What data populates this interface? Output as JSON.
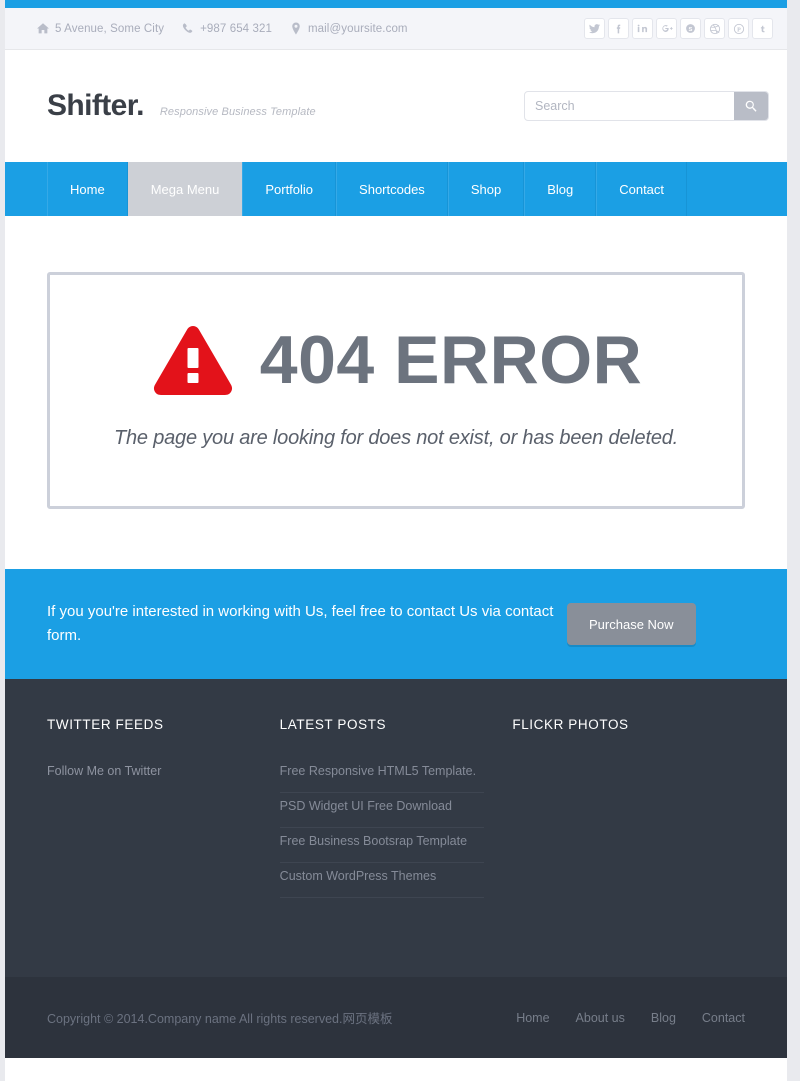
{
  "topbar": {
    "contacts": [
      {
        "icon": "home-icon",
        "text": "5 Avenue, Some City"
      },
      {
        "icon": "phone-icon",
        "text": "+987 654 321"
      },
      {
        "icon": "map-pin-icon",
        "text": "mail@yoursite.com"
      }
    ],
    "social": [
      {
        "name": "twitter-icon",
        "glyph": "t"
      },
      {
        "name": "facebook-icon",
        "glyph": "f"
      },
      {
        "name": "linkedin-icon",
        "glyph": "in"
      },
      {
        "name": "google-plus-icon",
        "glyph": "g+"
      },
      {
        "name": "skype-icon",
        "glyph": "s"
      },
      {
        "name": "dribbble-icon",
        "glyph": "d"
      },
      {
        "name": "pinterest-icon",
        "glyph": "p"
      },
      {
        "name": "tumblr-icon",
        "glyph": "t"
      }
    ]
  },
  "header": {
    "brand": "Shifter.",
    "tagline": "Responsive Business Template",
    "search_placeholder": "Search",
    "search_value": ""
  },
  "nav": {
    "items": [
      {
        "label": "Home",
        "active": false
      },
      {
        "label": "Mega Menu",
        "active": true
      },
      {
        "label": "Portfolio",
        "active": false
      },
      {
        "label": "Shortcodes",
        "active": false
      },
      {
        "label": "Shop",
        "active": false
      },
      {
        "label": "Blog",
        "active": false
      },
      {
        "label": "Contact",
        "active": false
      }
    ]
  },
  "error": {
    "icon": "warning-triangle-icon",
    "title": "404 ERROR",
    "subtitle": "The page you are looking for does not exist, or has been deleted."
  },
  "cta": {
    "text": "If you you're interested in working with Us, feel free to contact Us via contact form.",
    "button_label": "Purchase Now"
  },
  "footer": {
    "twitter": {
      "title": "TWITTER FEEDS",
      "follow_text": "Follow Me on Twitter"
    },
    "posts": {
      "title": "LATEST POSTS",
      "items": [
        "Free Responsive HTML5 Template.",
        "PSD Widget UI Free Download",
        "Free Business Bootsrap Template",
        "Custom WordPress Themes"
      ]
    },
    "flickr": {
      "title": "FLICKR PHOTOS",
      "photos": []
    }
  },
  "bottombar": {
    "copyright": "Copyright © 2014.Company name All rights reserved.网页模板",
    "links": [
      "Home",
      "About us",
      "Blog",
      "Contact"
    ]
  },
  "colors": {
    "accent_blue": "#1b9fe4",
    "footer_dark": "#333a45",
    "bottom_dark": "#2d333d",
    "error_red": "#e3121a",
    "error_gray": "#6c737e",
    "active_nav": "#cdd0d6"
  }
}
